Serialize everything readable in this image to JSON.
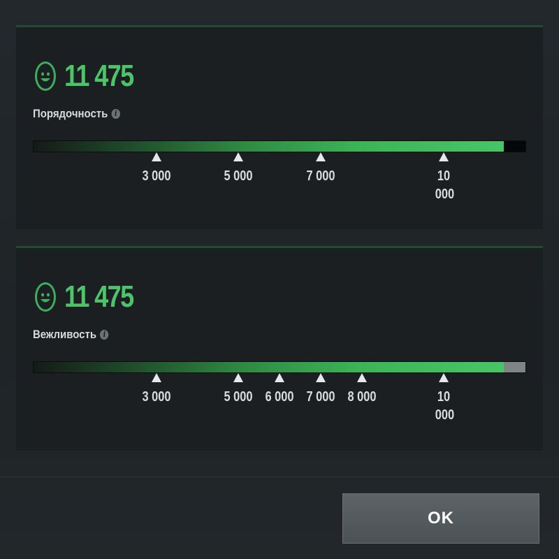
{
  "metrics": [
    {
      "id": "conduct",
      "score": "11 475",
      "label": "Порядочность",
      "info_icon": "info-icon",
      "face_icon": "smiley-face-icon",
      "progress": 0.956,
      "remainder_color": "#050607",
      "ticks": [
        {
          "value": 3000,
          "label": "3 000"
        },
        {
          "value": 5000,
          "label": "5 000"
        },
        {
          "value": 7000,
          "label": "7 000"
        },
        {
          "value": 10000,
          "label": "10 000",
          "wrapped": true
        }
      ]
    },
    {
      "id": "civility",
      "score": "11 475",
      "label": "Вежливость",
      "info_icon": "info-icon",
      "face_icon": "smiley-face-icon",
      "progress": 0.956,
      "remainder_color": "#7f8487",
      "ticks": [
        {
          "value": 3000,
          "label": "3 000"
        },
        {
          "value": 5000,
          "label": "5 000"
        },
        {
          "value": 6000,
          "label": "6 000"
        },
        {
          "value": 7000,
          "label": "7 000"
        },
        {
          "value": 8000,
          "label": "8 000"
        },
        {
          "value": 10000,
          "label": "10 000",
          "wrapped": true
        }
      ]
    }
  ],
  "scale": {
    "min": 0,
    "max": 12000
  },
  "footer": {
    "ok_label": "OK"
  },
  "colors": {
    "accent": "#4cc46a",
    "panel_border": "#244a33"
  }
}
